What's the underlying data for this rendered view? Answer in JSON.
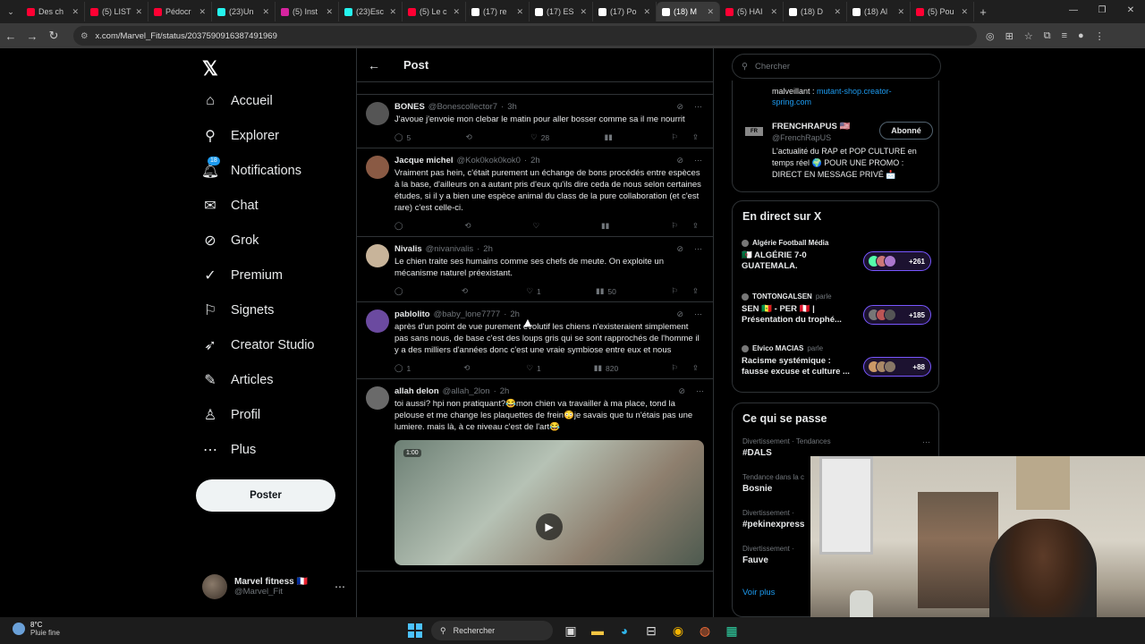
{
  "browser": {
    "tabs": [
      {
        "title": "Des ch",
        "color": "#ff0033"
      },
      {
        "title": "(5) LIST",
        "color": "#ff0033"
      },
      {
        "title": "Pédocr",
        "color": "#ff0033"
      },
      {
        "title": "(23)Un",
        "color": "#25f4ee"
      },
      {
        "title": "(5) Inst",
        "color": "#d6249f"
      },
      {
        "title": "(23)Esc",
        "color": "#25f4ee"
      },
      {
        "title": "(5) Le c",
        "color": "#ff0033"
      },
      {
        "title": "(17) re",
        "color": "#ffffff"
      },
      {
        "title": "(17) ES",
        "color": "#ffffff"
      },
      {
        "title": "(17) Po",
        "color": "#ffffff"
      },
      {
        "title": "(18) M",
        "color": "#ffffff",
        "active": true
      },
      {
        "title": "(5) HAI",
        "color": "#ff0033"
      },
      {
        "title": "(18) D",
        "color": "#ffffff"
      },
      {
        "title": "(18) Al",
        "color": "#ffffff"
      },
      {
        "title": "(5) Pou",
        "color": "#ff0033"
      }
    ],
    "url": "x.com/Marvel_Fit/status/2037590916387491969"
  },
  "nav": {
    "items": [
      {
        "label": "Accueil",
        "icon": "home-icon",
        "glyph": "⌂"
      },
      {
        "label": "Explorer",
        "icon": "search-icon",
        "glyph": "⚲"
      },
      {
        "label": "Notifications",
        "icon": "bell-icon",
        "glyph": "🔔︎",
        "badge": "18"
      },
      {
        "label": "Chat",
        "icon": "mail-icon",
        "glyph": "✉"
      },
      {
        "label": "Grok",
        "icon": "grok-icon",
        "glyph": "⊘"
      },
      {
        "label": "Premium",
        "icon": "premium-icon",
        "glyph": "✓"
      },
      {
        "label": "Signets",
        "icon": "bookmark-icon",
        "glyph": "⚐"
      },
      {
        "label": "Creator Studio",
        "icon": "rocket-icon",
        "glyph": "➶"
      },
      {
        "label": "Articles",
        "icon": "article-icon",
        "glyph": "✎"
      },
      {
        "label": "Profil",
        "icon": "person-icon",
        "glyph": "♙"
      },
      {
        "label": "Plus",
        "icon": "more-icon",
        "glyph": "⋯"
      }
    ],
    "post_label": "Poster",
    "account": {
      "name": "Marvel fitness 🇫🇷",
      "handle": "@Marvel_Fit"
    }
  },
  "main": {
    "title": "Post",
    "tweets": [
      {
        "name": "BONES",
        "handle": "@Bonescollector7",
        "time": "3h",
        "text": "J'avoue j'envoie mon clebar le matin pour aller bosser comme sa il me nourrit",
        "replies": "5",
        "reposts": "",
        "likes": "28",
        "views": "",
        "avatar": "#555"
      },
      {
        "name": "Jacque michel",
        "handle": "@Kok0kok0kok0",
        "time": "2h",
        "text": "Vraiment pas hein, c'était purement un échange de bons procédés entre espèces à la base, d'ailleurs on a autant pris d'eux qu'ils dire ceda de nous selon certaines études, si il y a bien une espèce animal du class de la pure collaboration (et c'est rare) c'est celle-ci.",
        "replies": "",
        "reposts": "",
        "likes": "",
        "views": "",
        "avatar": "#8a5a44"
      },
      {
        "name": "Nivalis",
        "handle": "@nivanivalis",
        "time": "2h",
        "text": "Le chien traite ses humains comme ses chefs de meute. On exploite un mécanisme naturel préexistant.",
        "replies": "",
        "reposts": "",
        "likes": "1",
        "views": "50",
        "avatar": "#c8b49a"
      },
      {
        "name": "pablolito",
        "handle": "@baby_lone7777",
        "time": "2h",
        "text": "après d'un point de vue purement évolutif les chiens n'existeraient simplement pas sans nous, de base c'est des loups gris qui se sont rapprochés de l'homme il y a des milliers d'années donc c'est une vraie symbiose entre eux et nous",
        "replies": "1",
        "reposts": "",
        "likes": "1",
        "views": "820",
        "avatar": "#6b4aa0"
      },
      {
        "name": "allah delon",
        "handle": "@allah_2lon",
        "time": "2h",
        "text": "toi aussi? hpi non pratiquant?😂mon chien va travailler à ma place, tond la pelouse et me change les plaquettes de frein😳je savais que tu n'étais pas une lumiere. mais là, à ce niveau c'est de l'art😂",
        "video_time": "1:00",
        "avatar": "#6a6a6a"
      }
    ]
  },
  "right": {
    "search_placeholder": "Chercher",
    "promo_text": "malveillant : ",
    "promo_link": "mutant-shop.creator-spring.com",
    "suggest": {
      "name": "FRENCHRAPUS 🇺🇸",
      "handle": "@FrenchRapUS",
      "follow_label": "Abonné",
      "bio": "L'actualité du RAP et POP CULTURE en temps réel 🌍 POUR UNE PROMO : DIRECT EN MESSAGE PRIVÉ 📩"
    },
    "live_title": "En direct sur X",
    "live": [
      {
        "host": "Algérie Football Média",
        "title": "🇩🇿 ALGÉRIE 7-0 GUATEMALA.",
        "count": "+261"
      },
      {
        "host": "TONTONGALSEN",
        "sub": "parle",
        "title": "SEN 🇸🇳 - PER 🇵🇪 | Présentation du trophé...",
        "count": "+185"
      },
      {
        "host": "Elvico MACIAS",
        "sub": "parle",
        "title": "Racisme systémique : fausse excuse et culture ...",
        "count": "+88"
      }
    ],
    "trends_title": "Ce qui se passe",
    "trends": [
      {
        "ctx": "Divertissement · Tendances",
        "name": "#DALS"
      },
      {
        "ctx": "Tendance dans la c",
        "name": "Bosnie"
      },
      {
        "ctx": "Divertissement ·",
        "name": "#pekinexpress"
      },
      {
        "ctx": "Divertissement ·",
        "name": "Fauve"
      }
    ],
    "show_more": "Voir plus"
  },
  "taskbar": {
    "temp": "8°C",
    "weather": "Pluie fine",
    "search": "Rechercher"
  }
}
